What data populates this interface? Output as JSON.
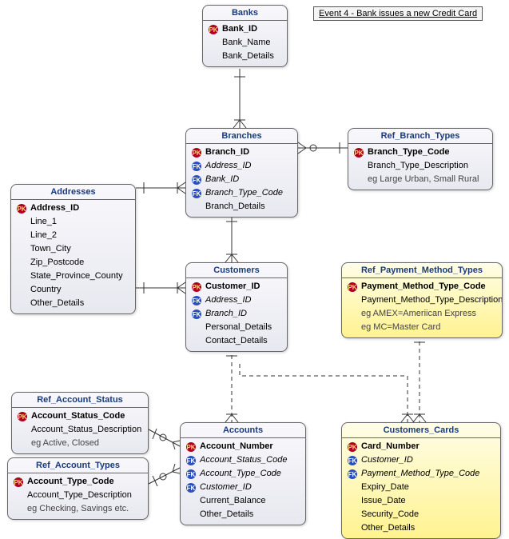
{
  "event_label": "Event 4 - Bank issues a new Credit Card",
  "entities": {
    "banks": {
      "title": "Banks",
      "attrs": [
        {
          "key": "pk",
          "name": "Bank_ID"
        },
        {
          "key": "",
          "name": "Bank_Name"
        },
        {
          "key": "",
          "name": "Bank_Details"
        }
      ]
    },
    "branches": {
      "title": "Branches",
      "attrs": [
        {
          "key": "pk",
          "name": "Branch_ID"
        },
        {
          "key": "fk",
          "name": "Address_ID"
        },
        {
          "key": "fk",
          "name": "Bank_ID"
        },
        {
          "key": "fk",
          "name": "Branch_Type_Code"
        },
        {
          "key": "",
          "name": "Branch_Details"
        }
      ]
    },
    "ref_branch_types": {
      "title": "Ref_Branch_Types",
      "attrs": [
        {
          "key": "pk",
          "name": "Branch_Type_Code"
        },
        {
          "key": "",
          "name": "Branch_Type_Description"
        },
        {
          "key": "",
          "name": "eg Large Urban, Small Rural"
        }
      ]
    },
    "addresses": {
      "title": "Addresses",
      "attrs": [
        {
          "key": "pk",
          "name": "Address_ID"
        },
        {
          "key": "",
          "name": "Line_1"
        },
        {
          "key": "",
          "name": "Line_2"
        },
        {
          "key": "",
          "name": "Town_City"
        },
        {
          "key": "",
          "name": "Zip_Postcode"
        },
        {
          "key": "",
          "name": "State_Province_County"
        },
        {
          "key": "",
          "name": "Country"
        },
        {
          "key": "",
          "name": "Other_Details"
        }
      ]
    },
    "customers": {
      "title": "Customers",
      "attrs": [
        {
          "key": "pk",
          "name": "Customer_ID"
        },
        {
          "key": "fk",
          "name": "Address_ID"
        },
        {
          "key": "fk",
          "name": "Branch_ID"
        },
        {
          "key": "",
          "name": "Personal_Details"
        },
        {
          "key": "",
          "name": "Contact_Details"
        }
      ]
    },
    "ref_payment_method_types": {
      "title": "Ref_Payment_Method_Types",
      "attrs": [
        {
          "key": "pk",
          "name": "Payment_Method_Type_Code"
        },
        {
          "key": "",
          "name": "Payment_Method_Type_Description"
        },
        {
          "key": "",
          "name": "eg AMEX=Ameriican Express"
        },
        {
          "key": "",
          "name": "eg MC=Master Card"
        }
      ]
    },
    "ref_account_status": {
      "title": "Ref_Account_Status",
      "attrs": [
        {
          "key": "pk",
          "name": "Account_Status_Code"
        },
        {
          "key": "",
          "name": "Account_Status_Description"
        },
        {
          "key": "",
          "name": "eg Active, Closed"
        }
      ]
    },
    "ref_account_types": {
      "title": "Ref_Account_Types",
      "attrs": [
        {
          "key": "pk",
          "name": "Account_Type_Code"
        },
        {
          "key": "",
          "name": "Account_Type_Description"
        },
        {
          "key": "",
          "name": "eg Checking, Savings etc."
        }
      ]
    },
    "accounts": {
      "title": "Accounts",
      "attrs": [
        {
          "key": "pk",
          "name": "Account_Number"
        },
        {
          "key": "fk",
          "name": "Account_Status_Code"
        },
        {
          "key": "fk",
          "name": "Account_Type_Code"
        },
        {
          "key": "fk",
          "name": "Customer_ID"
        },
        {
          "key": "",
          "name": "Current_Balance"
        },
        {
          "key": "",
          "name": "Other_Details"
        }
      ]
    },
    "customers_cards": {
      "title": "Customers_Cards",
      "attrs": [
        {
          "key": "pk",
          "name": "Card_Number"
        },
        {
          "key": "fk",
          "name": "Customer_ID"
        },
        {
          "key": "fk",
          "name": "Payment_Method_Type_Code"
        },
        {
          "key": "",
          "name": "Expiry_Date"
        },
        {
          "key": "",
          "name": "Issue_Date"
        },
        {
          "key": "",
          "name": "Security_Code"
        },
        {
          "key": "",
          "name": "Other_Details"
        }
      ]
    }
  },
  "chart_data": {
    "type": "er-diagram",
    "entities": [
      {
        "name": "Banks",
        "pk": [
          "Bank_ID"
        ],
        "attributes": [
          "Bank_ID",
          "Bank_Name",
          "Bank_Details"
        ]
      },
      {
        "name": "Branches",
        "pk": [
          "Branch_ID"
        ],
        "fk": [
          "Address_ID",
          "Bank_ID",
          "Branch_Type_Code"
        ],
        "attributes": [
          "Branch_ID",
          "Address_ID",
          "Bank_ID",
          "Branch_Type_Code",
          "Branch_Details"
        ]
      },
      {
        "name": "Ref_Branch_Types",
        "pk": [
          "Branch_Type_Code"
        ],
        "attributes": [
          "Branch_Type_Code",
          "Branch_Type_Description"
        ],
        "notes": [
          "eg Large Urban, Small Rural"
        ]
      },
      {
        "name": "Addresses",
        "pk": [
          "Address_ID"
        ],
        "attributes": [
          "Address_ID",
          "Line_1",
          "Line_2",
          "Town_City",
          "Zip_Postcode",
          "State_Province_County",
          "Country",
          "Other_Details"
        ]
      },
      {
        "name": "Customers",
        "pk": [
          "Customer_ID"
        ],
        "fk": [
          "Address_ID",
          "Branch_ID"
        ],
        "attributes": [
          "Customer_ID",
          "Address_ID",
          "Branch_ID",
          "Personal_Details",
          "Contact_Details"
        ]
      },
      {
        "name": "Ref_Payment_Method_Types",
        "pk": [
          "Payment_Method_Type_Code"
        ],
        "attributes": [
          "Payment_Method_Type_Code",
          "Payment_Method_Type_Description"
        ],
        "notes": [
          "eg AMEX=Ameriican Express",
          "eg MC=Master Card"
        ],
        "highlighted": true
      },
      {
        "name": "Ref_Account_Status",
        "pk": [
          "Account_Status_Code"
        ],
        "attributes": [
          "Account_Status_Code",
          "Account_Status_Description"
        ],
        "notes": [
          "eg Active, Closed"
        ]
      },
      {
        "name": "Ref_Account_Types",
        "pk": [
          "Account_Type_Code"
        ],
        "attributes": [
          "Account_Type_Code",
          "Account_Type_Description"
        ],
        "notes": [
          "eg Checking, Savings etc."
        ]
      },
      {
        "name": "Accounts",
        "pk": [
          "Account_Number"
        ],
        "fk": [
          "Account_Status_Code",
          "Account_Type_Code",
          "Customer_ID"
        ],
        "attributes": [
          "Account_Number",
          "Account_Status_Code",
          "Account_Type_Code",
          "Customer_ID",
          "Current_Balance",
          "Other_Details"
        ]
      },
      {
        "name": "Customers_Cards",
        "pk": [
          "Card_Number"
        ],
        "fk": [
          "Customer_ID",
          "Payment_Method_Type_Code"
        ],
        "attributes": [
          "Card_Number",
          "Customer_ID",
          "Payment_Method_Type_Code",
          "Expiry_Date",
          "Issue_Date",
          "Security_Code",
          "Other_Details"
        ],
        "highlighted": true
      }
    ],
    "relationships": [
      {
        "from": "Banks",
        "to": "Branches",
        "cardinality": "1:N"
      },
      {
        "from": "Ref_Branch_Types",
        "to": "Branches",
        "cardinality": "1:N"
      },
      {
        "from": "Addresses",
        "to": "Branches",
        "cardinality": "1:N"
      },
      {
        "from": "Addresses",
        "to": "Customers",
        "cardinality": "1:N"
      },
      {
        "from": "Branches",
        "to": "Customers",
        "cardinality": "1:N"
      },
      {
        "from": "Customers",
        "to": "Accounts",
        "cardinality": "1:N",
        "style": "dashed"
      },
      {
        "from": "Customers",
        "to": "Customers_Cards",
        "cardinality": "1:N",
        "style": "dashed"
      },
      {
        "from": "Ref_Account_Status",
        "to": "Accounts",
        "cardinality": "1:N"
      },
      {
        "from": "Ref_Account_Types",
        "to": "Accounts",
        "cardinality": "1:N"
      },
      {
        "from": "Ref_Payment_Method_Types",
        "to": "Customers_Cards",
        "cardinality": "1:N",
        "style": "dashed"
      }
    ],
    "title": "Event 4 - Bank issues a new Credit Card"
  }
}
